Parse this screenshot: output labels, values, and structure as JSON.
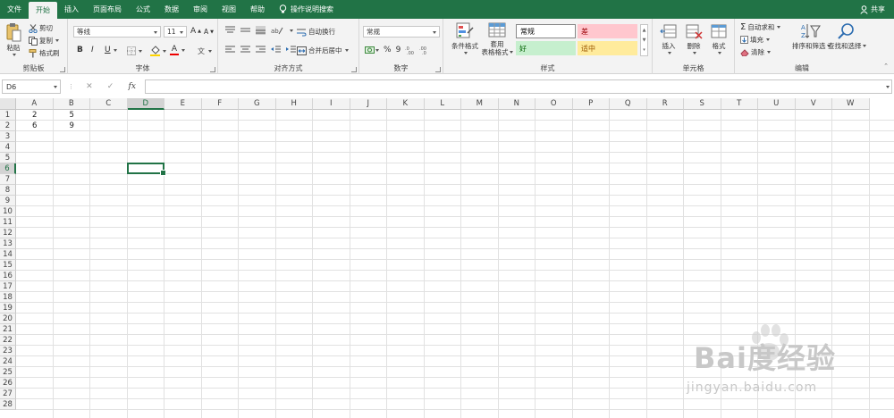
{
  "tabs": [
    "文件",
    "开始",
    "插入",
    "页面布局",
    "公式",
    "数据",
    "审阅",
    "视图",
    "帮助"
  ],
  "active_tab": "开始",
  "tell_me": "操作说明搜索",
  "share_label": "共享",
  "clipboard": {
    "paste": "粘贴",
    "cut": "剪切",
    "copy": "复制",
    "format_painter": "格式刷",
    "label": "剪贴板"
  },
  "font": {
    "name": "等线",
    "size": "11",
    "bold": "B",
    "italic": "I",
    "underline": "U",
    "grow": "A",
    "shrink": "A",
    "color_glyph": "A",
    "label": "字体"
  },
  "alignment": {
    "wrap": "自动换行",
    "merge": "合并后居中",
    "label": "对齐方式"
  },
  "number": {
    "format": "常规",
    "percent": "%",
    "comma": "9",
    "label": "数字"
  },
  "styles": {
    "conditional": "条件格式",
    "table_line1": "套用",
    "table_line2": "表格格式",
    "normal": "常规",
    "bad": "差",
    "good": "好",
    "neutral": "适中",
    "label": "样式"
  },
  "cells": {
    "insert": "插入",
    "delete": "删除",
    "format": "格式",
    "label": "单元格"
  },
  "editing": {
    "autosum": "自动求和",
    "fill": "填充",
    "clear": "清除",
    "sort": "排序和筛选",
    "find": "查找和选择",
    "label": "编辑"
  },
  "formula_bar": {
    "name_box": "D6",
    "cancel": "✕",
    "enter": "✓",
    "fx": "fx",
    "value": ""
  },
  "columns": [
    "A",
    "B",
    "C",
    "D",
    "E",
    "F",
    "G",
    "H",
    "I",
    "J",
    "K",
    "L",
    "M",
    "N",
    "O",
    "P",
    "Q",
    "R",
    "S",
    "T",
    "U",
    "V",
    "W"
  ],
  "rows": [
    "1",
    "2",
    "3",
    "4",
    "5",
    "6",
    "7",
    "8",
    "9",
    "10",
    "11",
    "12",
    "13",
    "14",
    "15",
    "16",
    "17",
    "18",
    "19",
    "20",
    "21",
    "22",
    "23",
    "24",
    "25",
    "26",
    "27",
    "28"
  ],
  "selected_cell": {
    "column": "D",
    "row": "6"
  },
  "sheet_values": {
    "A1": "2",
    "B1": "5",
    "A2": "6",
    "B2": "9"
  },
  "watermark": {
    "main": "Bai度经验",
    "sub": "jingyan.baidu.com"
  },
  "colors": {
    "excel_green": "#217346",
    "bad_fill": "#ffc7ce",
    "bad_text": "#9c0006",
    "good_fill": "#c6efce",
    "good_text": "#006100",
    "neutral_fill": "#ffeb9c",
    "neutral_text": "#9c5700"
  }
}
